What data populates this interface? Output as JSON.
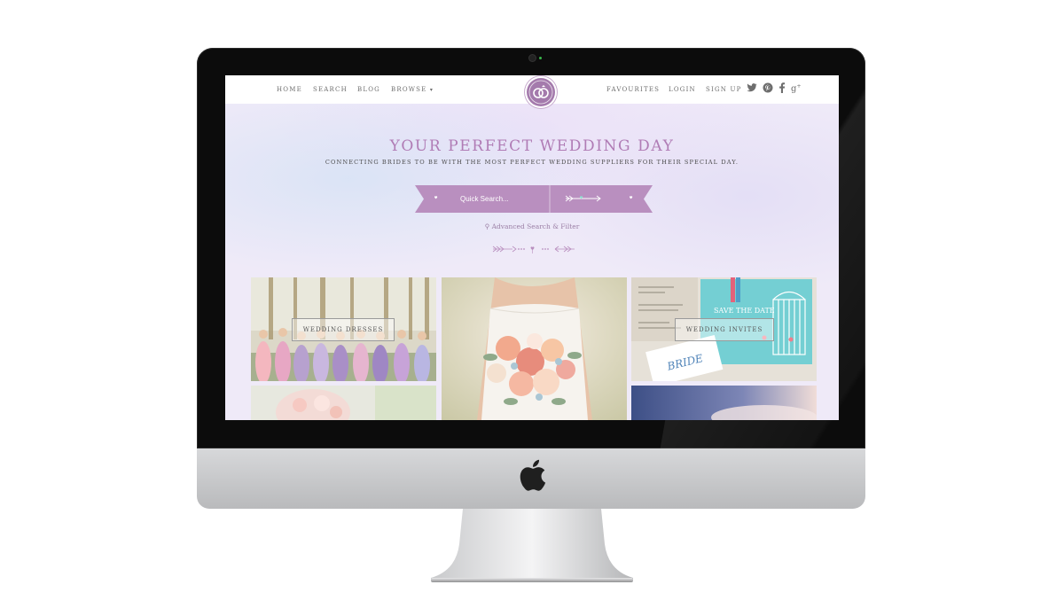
{
  "nav": {
    "left": [
      "HOME",
      "SEARCH",
      "BLOG",
      "BROWSE"
    ],
    "right": [
      "FAVOURITES",
      "LOGIN",
      "SIGN UP"
    ],
    "social_icons": [
      "twitter-icon",
      "pinterest-icon",
      "facebook-icon",
      "google-plus-icon"
    ]
  },
  "hero": {
    "title": "YOUR PERFECT WEDDING DAY",
    "subtitle": "CONNECTING BRIDES TO BE WITH THE MOST PERFECT WEDDING SUPPLIERS FOR THEIR SPECIAL DAY."
  },
  "search": {
    "placeholder": "Quick Search...",
    "advanced": "Advanced Search & Filter"
  },
  "tiles": [
    {
      "label": "WEDDING DRESSES"
    },
    {
      "label": "WEDDING INVITES"
    }
  ],
  "colors": {
    "accent": "#b07cb5",
    "banner": "#b98fbf"
  }
}
